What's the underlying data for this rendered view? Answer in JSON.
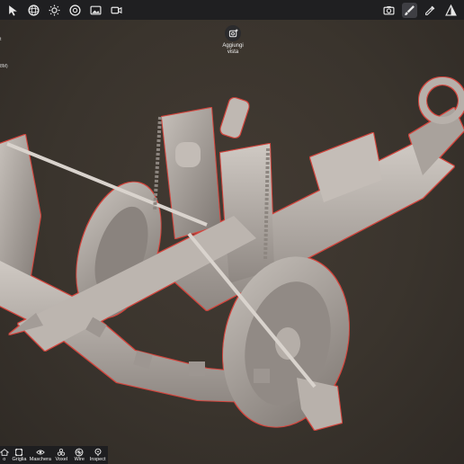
{
  "toolbar": {
    "left_icons": [
      "cursor-icon",
      "sphere-icon",
      "sun-icon",
      "material-ball-icon",
      "image-icon",
      "video-camera-icon"
    ],
    "right_icons": [
      "camera-icon",
      "brush-icon",
      "eyedropper-icon",
      "prism-icon"
    ]
  },
  "add_view": {
    "label": "Aggiungi\nvista"
  },
  "left_info": {
    "line1": "t",
    "line2": "8M)"
  },
  "bottom_nav": {
    "items": [
      {
        "icon": "home-icon",
        "label": "o"
      },
      {
        "icon": "grid-icon",
        "label": "Griglia"
      },
      {
        "icon": "eye-icon",
        "label": "Maschera"
      },
      {
        "icon": "voxel-icon",
        "label": "Voxel"
      },
      {
        "icon": "wire-icon",
        "label": "Wire"
      },
      {
        "icon": "inspect-icon",
        "label": "Inspect"
      }
    ]
  },
  "colors": {
    "background": "#3a342e",
    "toolbar": "#1f1f21",
    "model": "#b8b1ab",
    "outline": "#d2443c"
  }
}
